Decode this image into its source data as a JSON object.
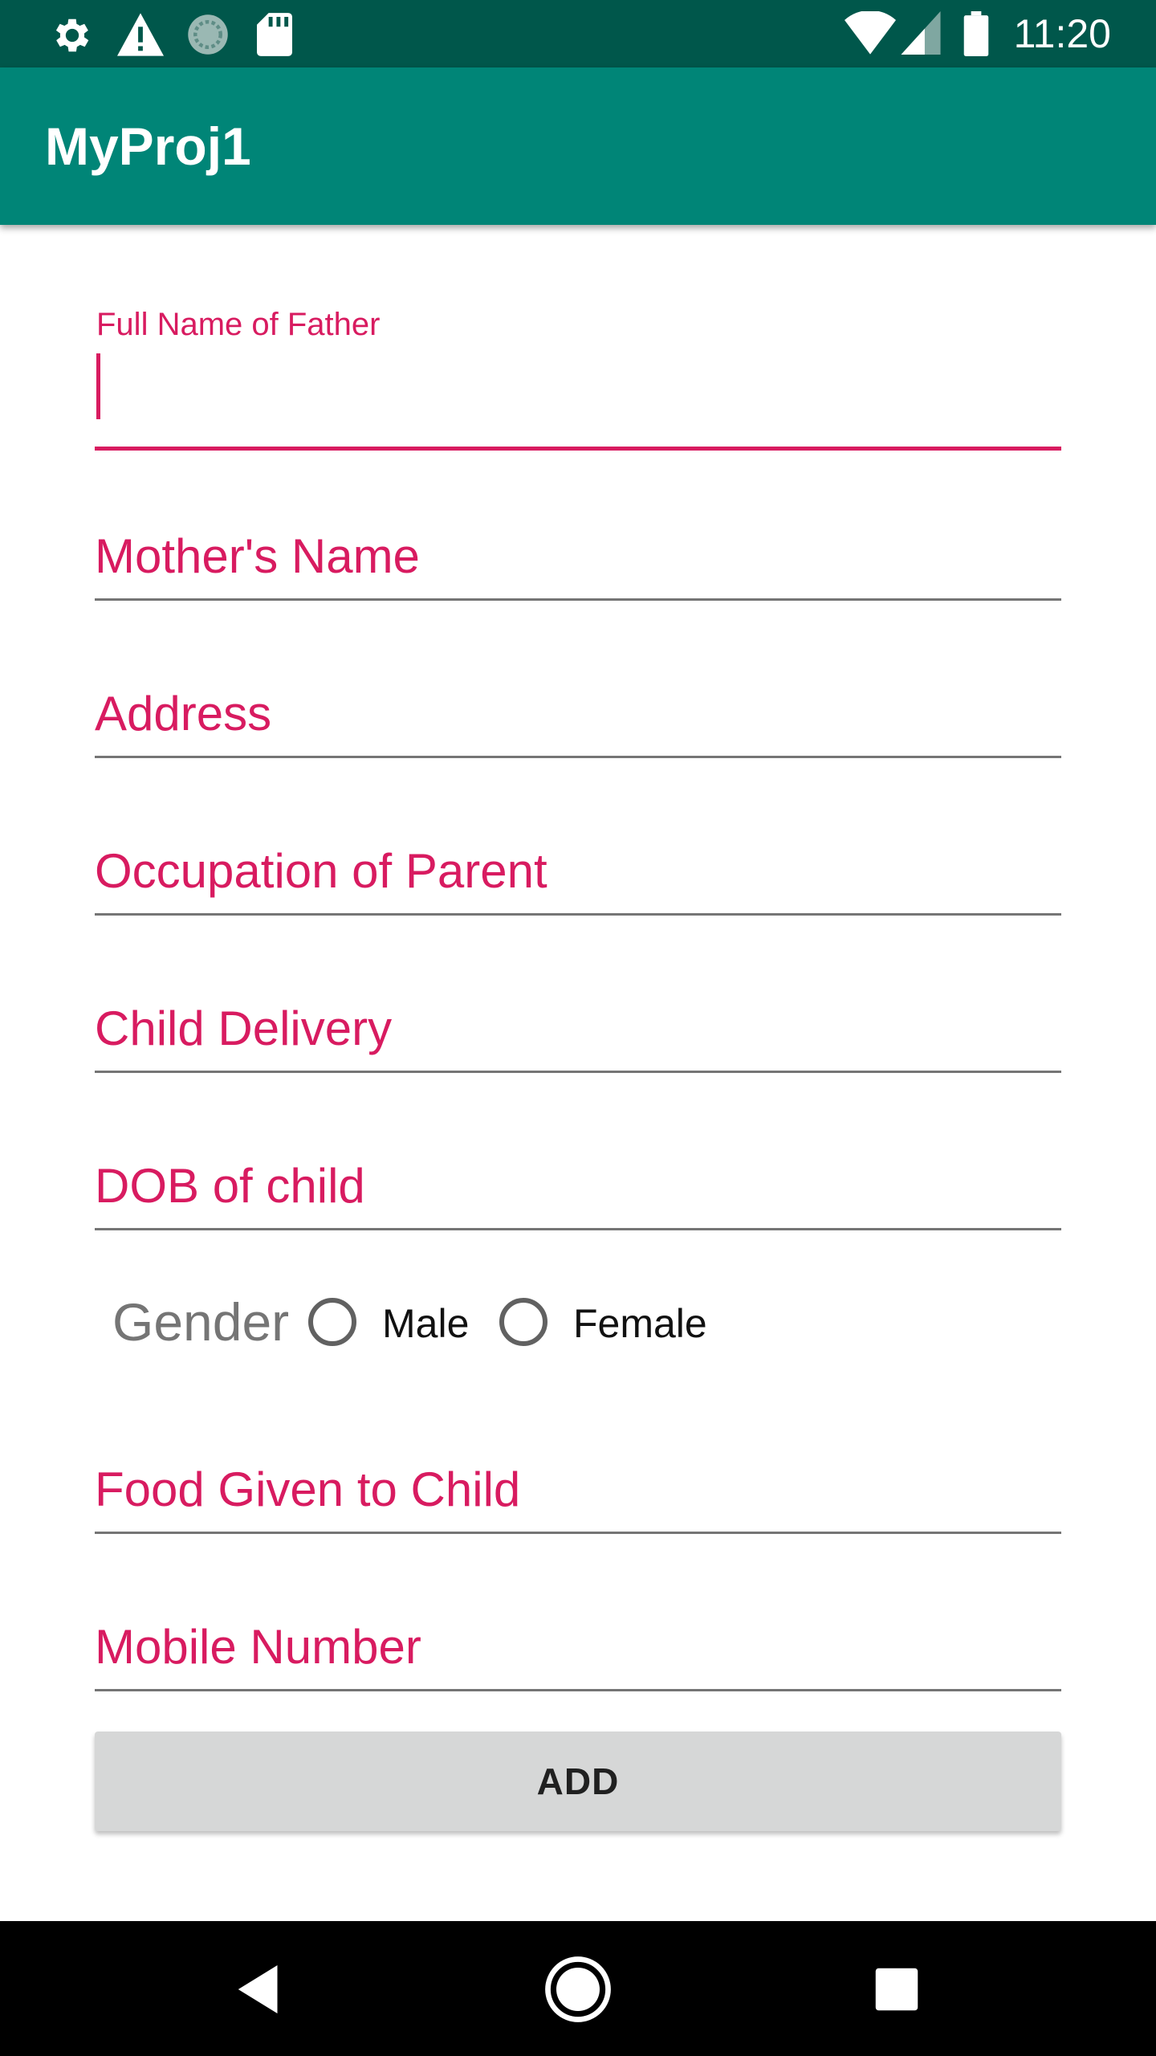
{
  "status_bar": {
    "time": "11:20",
    "left_icons": [
      "gear-icon",
      "warning-icon",
      "sync-icon",
      "sd-card-icon"
    ],
    "right_icons": [
      "wifi-icon",
      "signal-icon",
      "battery-icon"
    ]
  },
  "app_bar": {
    "title": "MyProj1"
  },
  "form": {
    "father_name": {
      "label": "Full Name of Father",
      "value": ""
    },
    "mother_name": {
      "placeholder": "Mother's Name"
    },
    "address": {
      "placeholder": "Address"
    },
    "occupation": {
      "placeholder": "Occupation of Parent"
    },
    "child_delivery": {
      "placeholder": "Child Delivery"
    },
    "dob": {
      "placeholder": "DOB of child"
    },
    "gender": {
      "label": "Gender",
      "options": [
        "Male",
        "Female"
      ],
      "selected": null
    },
    "food": {
      "placeholder": "Food Given to Child"
    },
    "mobile": {
      "placeholder": "Mobile Number"
    },
    "add_button": "ADD"
  },
  "nav_bar": {
    "buttons": [
      "back-icon",
      "home-icon",
      "recents-icon"
    ]
  },
  "colors": {
    "status_bar": "#00574b",
    "app_bar": "#008577",
    "accent": "#d81b60",
    "button": "#d6d7d7"
  }
}
